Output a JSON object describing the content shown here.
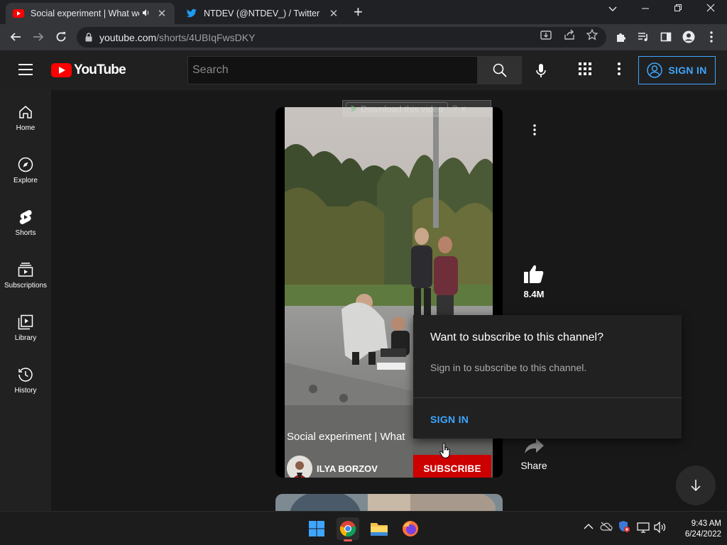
{
  "browser": {
    "tabs": [
      {
        "title": "Social experiment | What wo",
        "active": true
      },
      {
        "title": "NTDEV (@NTDEV_) / Twitter",
        "active": false
      }
    ],
    "url_host": "youtube.com",
    "url_path": "/shorts/4UBIqFwsDKY"
  },
  "header": {
    "logo_text": "YouTube",
    "search_placeholder": "Search",
    "signin_label": "SIGN IN"
  },
  "sidebar": {
    "items": [
      {
        "label": "Home",
        "icon": "home-icon"
      },
      {
        "label": "Explore",
        "icon": "compass-icon"
      },
      {
        "label": "Shorts",
        "icon": "shorts-icon"
      },
      {
        "label": "Subscriptions",
        "icon": "subscriptions-icon"
      },
      {
        "label": "Library",
        "icon": "library-icon"
      },
      {
        "label": "History",
        "icon": "history-icon"
      }
    ]
  },
  "video": {
    "title": "Social experiment | What",
    "channel": "ILYA BORZOV",
    "subscribe_label": "SUBSCRIBE",
    "download_label": "Download this video",
    "download_help": "?",
    "download_close": "x",
    "likes": "8.4M",
    "share_label": "Share"
  },
  "popup": {
    "heading": "Want to subscribe to this channel?",
    "body": "Sign in to subscribe to this channel.",
    "signin_label": "SIGN IN"
  },
  "taskbar": {
    "time": "9:43 AM",
    "date": "6/24/2022"
  },
  "colors": {
    "accent_blue": "#3ea6ff",
    "youtube_red": "#ff0000",
    "subscribe_red": "#cc0000"
  }
}
